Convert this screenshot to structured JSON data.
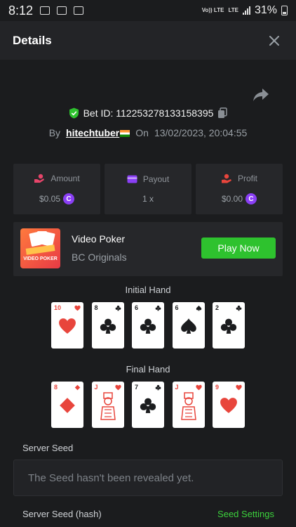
{
  "status_bar": {
    "time": "8:12",
    "volte": "Vo)) LTE",
    "lte": "LTE",
    "battery": "31%"
  },
  "header": {
    "title": "Details",
    "close_icon": "close-icon"
  },
  "bet": {
    "id_text": "Bet ID: 112253278133158395",
    "by_label": "By",
    "username": "hitechtuber",
    "on_label": "On",
    "datetime": "13/02/2023, 20:04:55"
  },
  "stats": {
    "amount_label": "Amount",
    "amount_value": "$0.05",
    "payout_label": "Payout",
    "payout_value": "1 x",
    "profit_label": "Profit",
    "profit_value": "$0.00"
  },
  "game": {
    "name": "Video Poker",
    "provider": "BC Originals",
    "play_label": "Play Now",
    "thumb_text": "VIDEO POKER"
  },
  "initial_hand": {
    "title": "Initial Hand",
    "cards": [
      {
        "rank": "10",
        "suit": "hearts",
        "color": "#e8453c"
      },
      {
        "rank": "8",
        "suit": "clubs",
        "color": "#1b1c1e"
      },
      {
        "rank": "6",
        "suit": "clubs",
        "color": "#1b1c1e"
      },
      {
        "rank": "6",
        "suit": "spades",
        "color": "#1b1c1e"
      },
      {
        "rank": "2",
        "suit": "clubs",
        "color": "#1b1c1e"
      }
    ]
  },
  "final_hand": {
    "title": "Final Hand",
    "cards": [
      {
        "rank": "8",
        "suit": "diamonds",
        "color": "#e8453c"
      },
      {
        "rank": "J",
        "suit": "hearts",
        "color": "#e8453c"
      },
      {
        "rank": "7",
        "suit": "clubs",
        "color": "#1b1c1e"
      },
      {
        "rank": "J",
        "suit": "hearts",
        "color": "#e8453c"
      },
      {
        "rank": "9",
        "suit": "hearts",
        "color": "#e8453c"
      }
    ]
  },
  "server_seed": {
    "label": "Server Seed",
    "value": "The Seed hasn't been revealed yet.",
    "hash_label": "Server Seed (hash)",
    "settings_label": "Seed Settings"
  },
  "colors": {
    "accent_green": "#2ec22e",
    "coin_purple": "#8a3ff5",
    "suit_red": "#e8453c"
  }
}
